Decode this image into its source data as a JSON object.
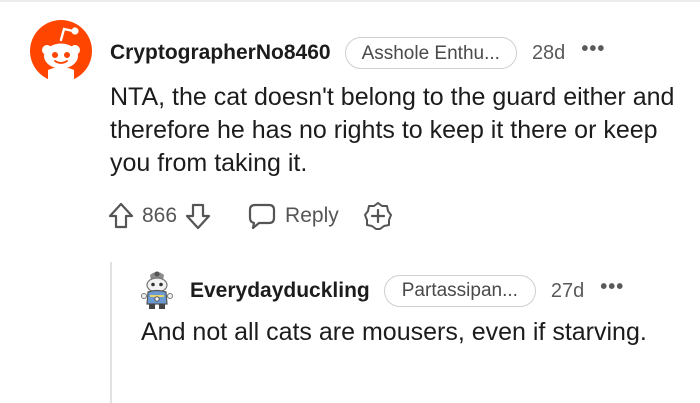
{
  "comment": {
    "username": "CryptographerNo8460",
    "flair": "Asshole Enthu...",
    "age": "28d",
    "more": "•••",
    "body": "NTA, the cat doesn't belong to the guard either and therefore he has no rights to keep it there or keep you from taking it.",
    "score": "866",
    "reply_label": "Reply",
    "avatar_icon": "reddit-snoo-avatar",
    "avatar_color": "#ff4500"
  },
  "reply": {
    "username": "Everydayduckling",
    "flair": "Partassipan...",
    "age": "27d",
    "more": "•••",
    "body": "And not all cats are mousers, even if starving.",
    "avatar_icon": "snoo-costume-avatar"
  }
}
